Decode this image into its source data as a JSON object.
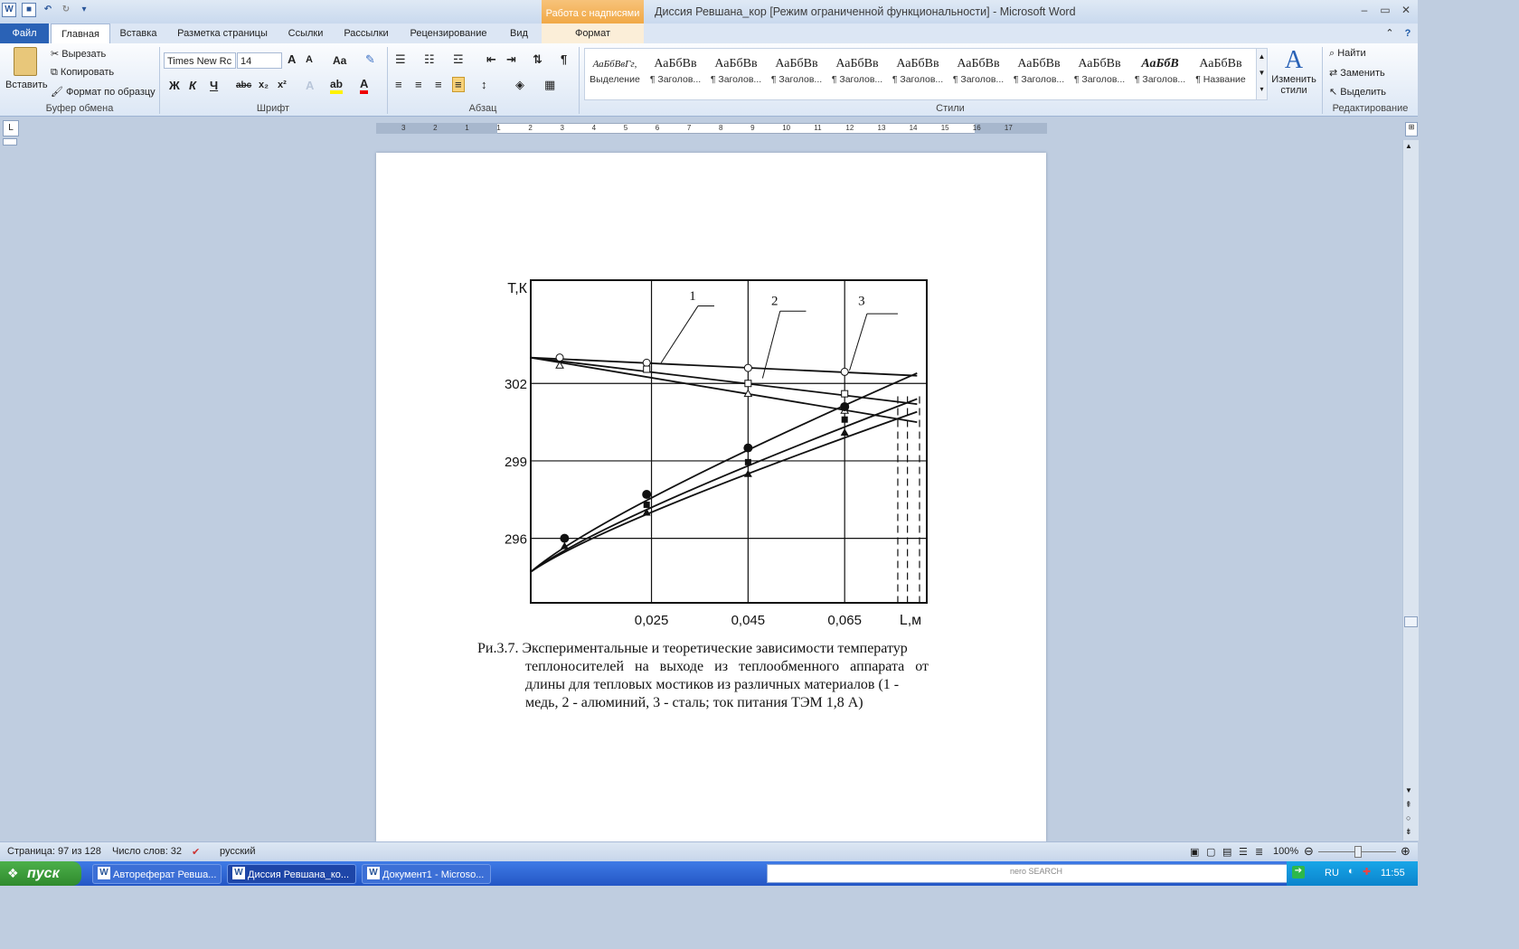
{
  "app": {
    "title": "Диссия  Ревшана_кор [Режим ограниченной функциональности]  -  Microsoft Word",
    "context_tab_group": "Работа с надписями"
  },
  "tabs": [
    "Файл",
    "Главная",
    "Вставка",
    "Разметка страницы",
    "Ссылки",
    "Рассылки",
    "Рецензирование",
    "Вид",
    "Формат"
  ],
  "clipboard": {
    "paste": "Вставить",
    "cut": "Вырезать",
    "copy": "Копировать",
    "format_painter": "Формат по образцу",
    "label": "Буфер обмена"
  },
  "font": {
    "name": "Times New Rc",
    "size": "14",
    "label": "Шрифт"
  },
  "paragraph": {
    "label": "Абзац"
  },
  "styles": {
    "label": "Стили",
    "items": [
      {
        "preview": "АаБбВвГг,",
        "name": "Выделение"
      },
      {
        "preview": "АаБбВв",
        "name": "¶ Заголов..."
      },
      {
        "preview": "АаБбВв",
        "name": "¶ Заголов..."
      },
      {
        "preview": "АаБбВв",
        "name": "¶ Заголов..."
      },
      {
        "preview": "АаБбВв",
        "name": "¶ Заголов..."
      },
      {
        "preview": "АаБбВв",
        "name": "¶ Заголов..."
      },
      {
        "preview": "АаБбВв",
        "name": "¶ Заголов..."
      },
      {
        "preview": "АаБбВв",
        "name": "¶ Заголов..."
      },
      {
        "preview": "АаБбВв",
        "name": "¶ Заголов..."
      },
      {
        "preview": "АаБбВ",
        "name": "¶ Заголов..."
      },
      {
        "preview": "АаБбВв",
        "name": "¶ Название"
      }
    ],
    "change": "Изменить стили"
  },
  "editing": {
    "find": "Найти",
    "replace": "Заменить",
    "select": "Выделить",
    "label": "Редактирование"
  },
  "ruler": [
    "3",
    "2",
    "1",
    "1",
    "2",
    "3",
    "4",
    "5",
    "6",
    "7",
    "8",
    "9",
    "10",
    "11",
    "12",
    "13",
    "14",
    "15",
    "16",
    "17"
  ],
  "chart_data": {
    "type": "line",
    "ylabel": "Т,К",
    "xlabel": "L,м",
    "y_ticks": [
      "302",
      "299",
      "296"
    ],
    "x_ticks": [
      "0,025",
      "0,045",
      "0,065"
    ],
    "curve_labels": [
      "1",
      "2",
      "3"
    ],
    "series": [
      {
        "name": "1",
        "values": [
          [
            0.0,
            303.0
          ],
          [
            0.08,
            300.5
          ]
        ]
      },
      {
        "name": "2",
        "values": [
          [
            0.0,
            303.0
          ],
          [
            0.08,
            301.2
          ]
        ]
      },
      {
        "name": "3",
        "values": [
          [
            0.0,
            303.0
          ],
          [
            0.08,
            302.3
          ]
        ]
      },
      {
        "name": "1",
        "values": [
          [
            0.0,
            294.7
          ],
          [
            0.08,
            302.4
          ]
        ]
      },
      {
        "name": "2",
        "values": [
          [
            0.0,
            294.7
          ],
          [
            0.08,
            301.4
          ]
        ]
      },
      {
        "name": "3",
        "values": [
          [
            0.0,
            294.7
          ],
          [
            0.08,
            300.9
          ]
        ]
      }
    ],
    "xlim": [
      0.0,
      0.082
    ],
    "ylim": [
      293.5,
      306.0
    ]
  },
  "caption": {
    "line1": "Ри.3.7. Экспериментальные и теоретические зависимости температур",
    "line2": "теплоносителей на выходе из теплообменного аппарата от",
    "line3": "длины для тепловых мостиков из различных материалов (1 -",
    "line4": "медь, 2 - алюминий, 3 - сталь; ток питания ТЭМ 1,8 А)"
  },
  "status": {
    "page": "Страница: 97 из 128",
    "words": "Число слов: 32",
    "lang": "русский",
    "zoom": "100%"
  },
  "taskbar": {
    "start": "пуск",
    "items": [
      "Автореферат Ревша...",
      "Диссия  Ревшана_ко...",
      "Документ1 - Microso..."
    ],
    "nero": "nero SEARCH",
    "lang": "RU",
    "time": "11:55"
  }
}
